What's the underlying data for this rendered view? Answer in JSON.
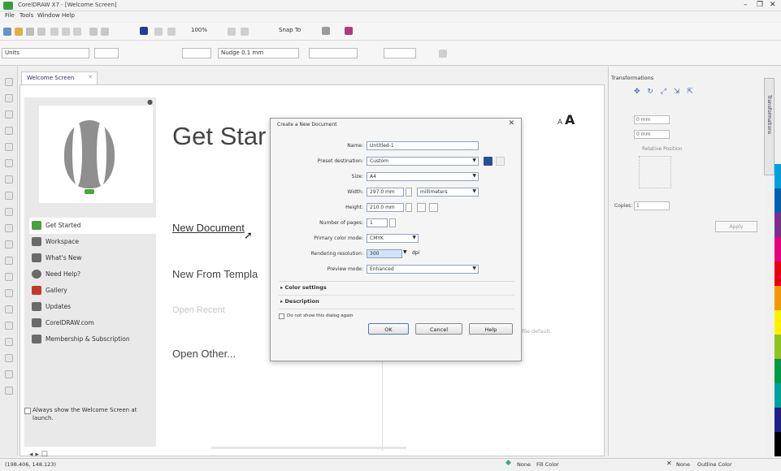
{
  "window": {
    "title": "CorelDRAW X7 - [Welcome Screen]",
    "controls": {
      "minimize": "–",
      "restore": "❐",
      "close": "✕"
    }
  },
  "menu": [
    "File",
    "Tools",
    "Window",
    "Help"
  ],
  "toolbar": {
    "zoom": "100%",
    "snap_label": "Snap To"
  },
  "property_bar": {
    "units_box": "Units",
    "spacing_box": "Nudge 0.1 mm"
  },
  "doc_tab": {
    "label": "Welcome Screen",
    "close": "✕"
  },
  "welcome": {
    "font_size_toggle": "A",
    "font_size_toggle_big": "A",
    "heading": "Get Star",
    "links": {
      "new_document": "New Document",
      "new_from_template": "New From Templa",
      "open_recent": "Open Recent",
      "open_other": "Open Other..."
    },
    "faint_text": "file default"
  },
  "sidebar": {
    "items": [
      {
        "label": "Get Started",
        "icon": "get-started-icon"
      },
      {
        "label": "Workspace",
        "icon": "workspace-icon"
      },
      {
        "label": "What's New",
        "icon": "whats-new-icon"
      },
      {
        "label": "Need Help?",
        "icon": "help-icon"
      },
      {
        "label": "Gallery",
        "icon": "gallery-icon"
      },
      {
        "label": "Updates",
        "icon": "updates-icon"
      },
      {
        "label": "CorelDRAW.com",
        "icon": "corel-web-icon"
      },
      {
        "label": "Membership & Subscription",
        "icon": "membership-icon"
      }
    ],
    "always_show": "Always show the Welcome Screen at launch."
  },
  "dialog": {
    "title": "Create a New Document",
    "close": "✕",
    "fields": {
      "name_label": "Name:",
      "name_value": "Untitled-1",
      "preset_label": "Preset destination:",
      "preset_value": "Custom",
      "size_label": "Size:",
      "size_value": "A4",
      "width_label": "Width:",
      "width_value": "297.0 mm",
      "width_unit": "millimeters",
      "height_label": "Height:",
      "height_value": "210.0 mm",
      "pages_label": "Number of pages:",
      "pages_value": "1",
      "color_mode_label": "Primary color mode:",
      "color_mode_value": "CMYK",
      "resolution_label": "Rendering resolution:",
      "resolution_value": "300",
      "resolution_unit": "dpi",
      "preview_label": "Preview mode:",
      "preview_value": "Enhanced"
    },
    "color_settings": "Color settings",
    "description": "Description",
    "dont_show": "Do not show this dialog again",
    "ok": "OK",
    "cancel": "Cancel",
    "help": "Help"
  },
  "right_panel": {
    "title": "Transformations",
    "x_box": "0 mm",
    "y_box": "0 mm",
    "relative": "Relative Position",
    "copies_label": "Copies:",
    "copies_value": "1",
    "apply": "Apply",
    "docker_tab": "Transformations"
  },
  "palette": [
    "#00a0e0",
    "#0060b0",
    "#7a2e8f",
    "#e4007f",
    "#e60012",
    "#f39800",
    "#fff100",
    "#8fc31f",
    "#009944",
    "#00a0a0",
    "#1d2088",
    "#000000"
  ],
  "status": {
    "coords": "(198.406, 148.123)",
    "fill": "None",
    "outline": "None",
    "fill_label": "Fill Color",
    "outline_label": "Outline Color"
  }
}
